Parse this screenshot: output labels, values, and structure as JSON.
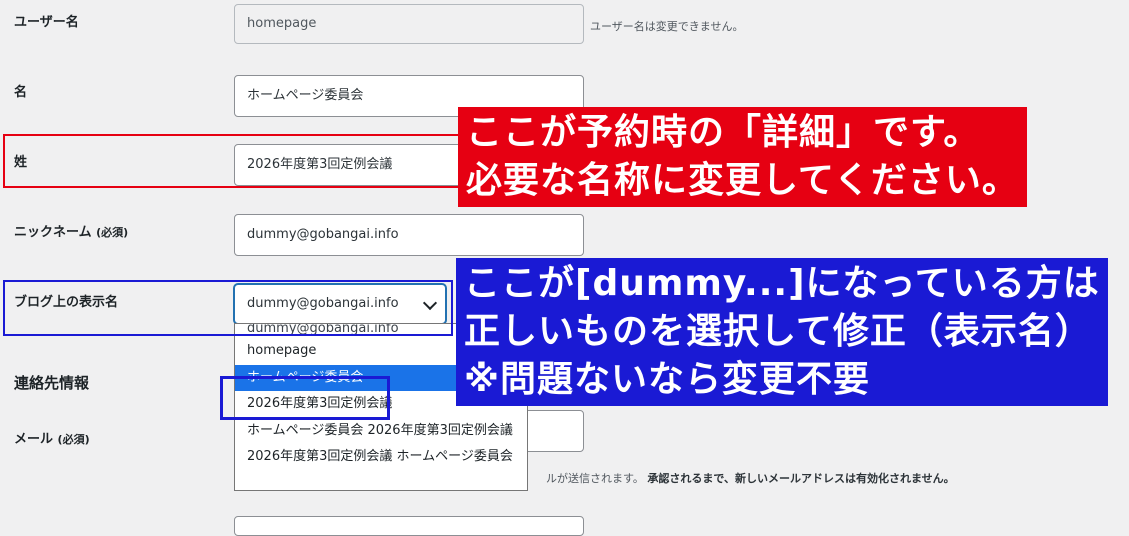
{
  "fields": {
    "username": {
      "label": "ユーザー名",
      "value": "homepage",
      "hint": "ユーザー名は変更できません。"
    },
    "first_name": {
      "label": "名",
      "value": "ホームページ委員会"
    },
    "last_name": {
      "label": "姓",
      "value": "2026年度第3回定例会議"
    },
    "nickname": {
      "label": "ニックネーム",
      "required": "(必須)",
      "value": "dummy@gobangai.info"
    },
    "display_name": {
      "label": "ブログ上の表示名",
      "value": "dummy@gobangai.info"
    },
    "contact_section": "連絡先情報",
    "email": {
      "label": "メール",
      "required": "(必須)",
      "hint_prefix": "ルが送信されます。",
      "hint_bold": "承認されるまで、新しいメールアドレスは有効化されません。"
    }
  },
  "dropdown": {
    "options": [
      "dummy@gobangai.info",
      "homepage",
      "ホームページ委員会",
      "2026年度第3回定例会議",
      "ホームページ委員会 2026年度第3回定例会議",
      "2026年度第3回定例会議 ホームページ委員会"
    ],
    "selected_index": 2
  },
  "annotations": {
    "red_line1": "ここが予約時の「詳細」です。",
    "red_line2": "必要な名称に変更してください。",
    "blue_line1": "ここが[dummy...]になっている方は",
    "blue_line2": "正しいものを選択して修正（表示名）",
    "blue_line3": "※問題ないなら変更不要"
  },
  "colors": {
    "annotation_red": "#e60012",
    "annotation_blue": "#1a1ad4",
    "selected_option": "#1a73e8"
  }
}
